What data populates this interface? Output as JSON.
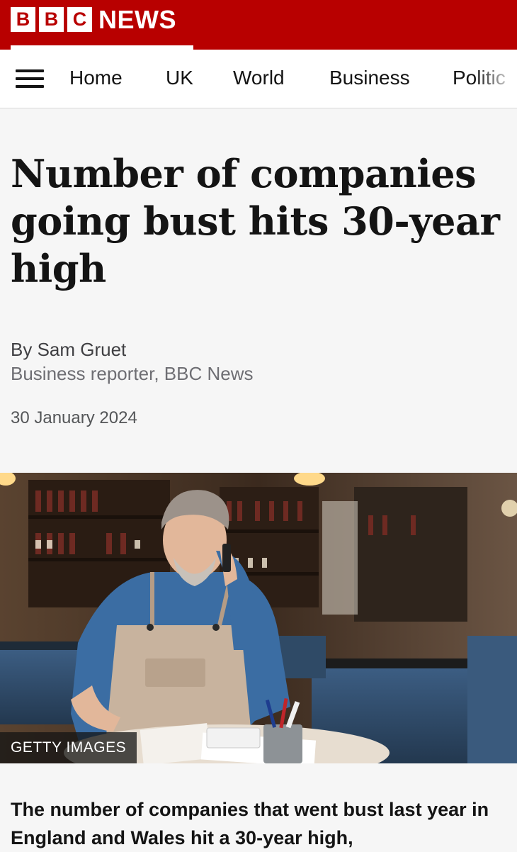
{
  "brand": {
    "letters": [
      "B",
      "B",
      "C"
    ],
    "name": "NEWS",
    "color": "#b80000"
  },
  "nav": {
    "menu_icon": "hamburger-menu-icon",
    "items": [
      "Home",
      "UK",
      "World",
      "Business",
      "Politic"
    ]
  },
  "article": {
    "headline": "Number of companies going bust hits 30-year high",
    "author": "By Sam Gruet",
    "role": "Business reporter, BBC News",
    "date": "30 January 2024",
    "image_credit": "GETTY IMAGES",
    "lead": "The number of companies that went bust last year in England and Wales hit a 30-year high,"
  }
}
